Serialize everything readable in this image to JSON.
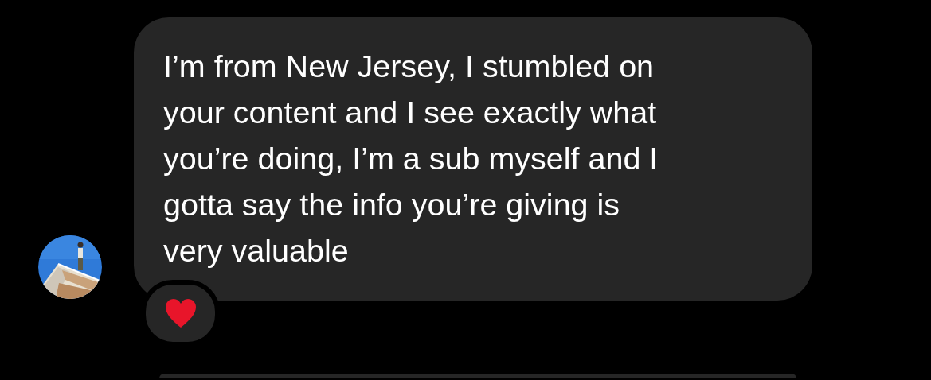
{
  "messages": [
    {
      "kind": "text",
      "lines": [
        "I’m from New Jersey, I stumbled on",
        "your content and I see exactly what",
        "you’re doing, I’m a sub myself and I",
        "gotta say the info you’re giving is",
        "very valuable"
      ],
      "reaction": {
        "kind": "heart"
      }
    },
    {
      "kind": "cut"
    }
  ]
}
